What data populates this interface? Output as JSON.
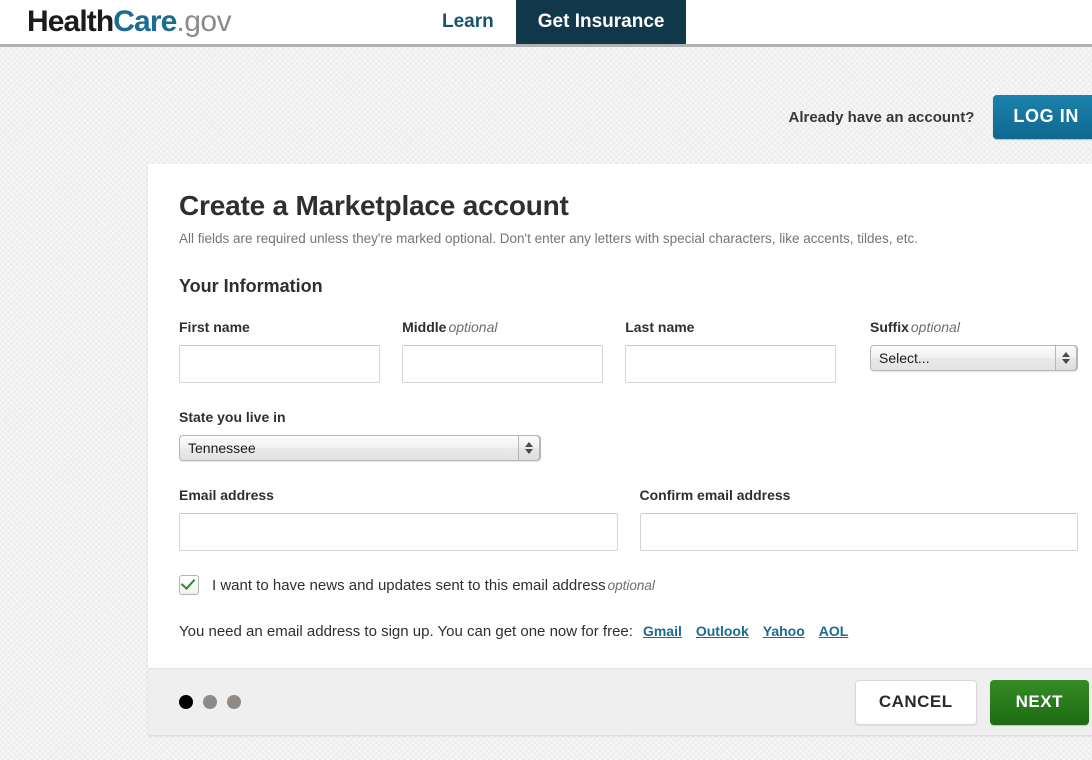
{
  "header": {
    "logo": {
      "part1": "Health",
      "part2": "Care",
      "part3": ".gov",
      "color1": "#1b1b1b",
      "color2": "#1b6b93",
      "color3": "#8b8b8b"
    },
    "nav": [
      {
        "label": "Learn",
        "active": false
      },
      {
        "label": "Get Insurance",
        "active": true
      }
    ],
    "nav_active_bg": "#11374b"
  },
  "account_bar": {
    "question": "Already have an account?",
    "login_label": "LOG IN",
    "login_color": "#11749e"
  },
  "card": {
    "title": "Create a Marketplace account",
    "subtitle": "All fields are required unless they're marked optional. Don't enter any letters with special characters, like accents, tildes, etc.",
    "section_title": "Your Information",
    "fields": {
      "first_name": {
        "label": "First name",
        "value": "",
        "placeholder": ""
      },
      "middle_name": {
        "label": "Middle",
        "optional": "optional",
        "value": "",
        "placeholder": ""
      },
      "last_name": {
        "label": "Last name",
        "value": "",
        "placeholder": ""
      },
      "suffix": {
        "label": "Suffix",
        "optional": "optional",
        "value": "Select..."
      },
      "state": {
        "label": "State you live in",
        "value": "Tennessee"
      },
      "email": {
        "label": "Email address",
        "value": "",
        "placeholder": ""
      },
      "confirm_email": {
        "label": "Confirm email address",
        "value": "",
        "placeholder": ""
      }
    },
    "newsletter": {
      "checked": true,
      "label": "I want to have news and updates sent to this email address",
      "optional": "optional",
      "check_color": "#2e8b2e"
    },
    "email_help": {
      "text": "You need an email address to sign up. You can get one now for free:",
      "links": [
        "Gmail",
        "Outlook",
        "Yahoo",
        "AOL"
      ],
      "link_color": "#1b6b93"
    }
  },
  "footer": {
    "steps": {
      "total": 3,
      "current": 1
    },
    "cancel_label": "CANCEL",
    "next_label": "NEXT",
    "next_color": "#2b7d1e"
  }
}
